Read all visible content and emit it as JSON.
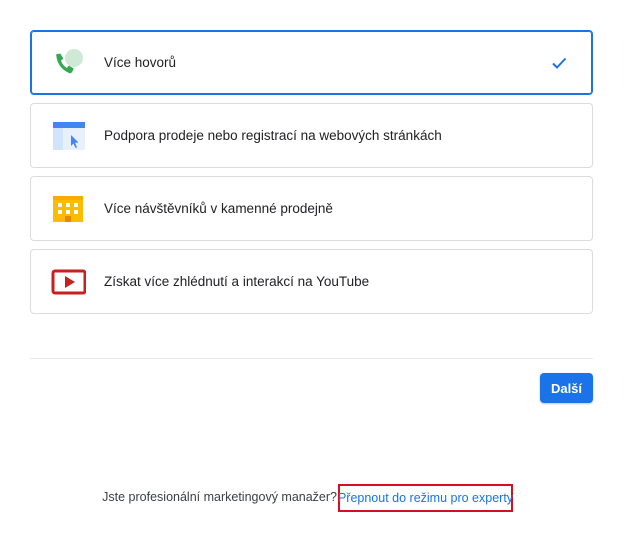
{
  "goals": [
    {
      "label": "Více hovorů",
      "icon": "phone-icon",
      "selected": true
    },
    {
      "label": "Podpora prodeje nebo registrací na webových stránkách",
      "icon": "website-icon",
      "selected": false
    },
    {
      "label": "Více návštěvníků v kamenné prodejně",
      "icon": "store-building-icon",
      "selected": false
    },
    {
      "label": "Získat více zhlédnutí a interakcí na YouTube",
      "icon": "youtube-play-icon",
      "selected": false
    }
  ],
  "selected_check_icon": "checkmark-icon",
  "next_button": {
    "label": "Další"
  },
  "footer": {
    "question": "Jste profesionální marketingový manažer?",
    "expert_link": "Přepnout do režimu pro experty"
  },
  "colors": {
    "accent": "#1a73e8",
    "border": "#dadce0",
    "highlight_box": "#d50f1f",
    "phone_green": "#34a853",
    "store_yellow": "#fbbc04",
    "youtube_red": "#c5221f"
  }
}
